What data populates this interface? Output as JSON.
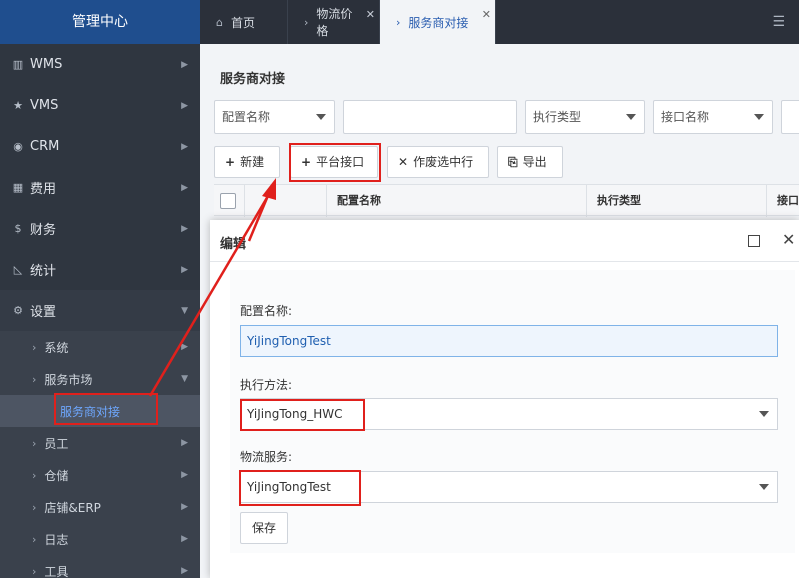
{
  "sidebar": {
    "title": "管理中心",
    "items": [
      {
        "label": "WMS",
        "icon": "bank-icon"
      },
      {
        "label": "VMS",
        "icon": "star-icon"
      },
      {
        "label": "CRM",
        "icon": "user-circle-icon"
      },
      {
        "label": "费用",
        "icon": "grid-icon"
      },
      {
        "label": "财务",
        "icon": "dollar-icon"
      },
      {
        "label": "统计",
        "icon": "chart-icon"
      },
      {
        "label": "设置",
        "icon": "gear-icon"
      }
    ],
    "sub_items": [
      {
        "label": "系统"
      },
      {
        "label": "服务市场"
      },
      {
        "label": "服务商对接"
      },
      {
        "label": "员工"
      },
      {
        "label": "仓储"
      },
      {
        "label": "店铺&ERP"
      },
      {
        "label": "日志"
      },
      {
        "label": "工具"
      }
    ]
  },
  "tabs": [
    {
      "label": "首页"
    },
    {
      "label": "物流价格"
    },
    {
      "label": "服务商对接"
    }
  ],
  "main": {
    "title": "服务商对接",
    "filters": {
      "config_name": "配置名称",
      "exec_type": "执行类型",
      "api_name": "接口名称"
    },
    "toolbar": {
      "new": "新建",
      "platform": "平台接口",
      "disable": "作废选中行",
      "export": "导出"
    },
    "table": {
      "headers": [
        "配置名称",
        "执行类型",
        "接口"
      ]
    }
  },
  "modal": {
    "title": "编辑",
    "labels": {
      "config_name": "配置名称:",
      "exec_method": "执行方法:",
      "logistics": "物流服务:"
    },
    "values": {
      "config_name": "YiJingTongTest",
      "exec_method": "YiJingTong_HWC",
      "logistics": "YiJingTongTest"
    },
    "save": "保存"
  },
  "colors": {
    "sidebar_bg": "#2f3640",
    "header_blue": "#1f4e8e",
    "highlight_red": "#e0201c",
    "active_link": "#6ea8ff"
  }
}
